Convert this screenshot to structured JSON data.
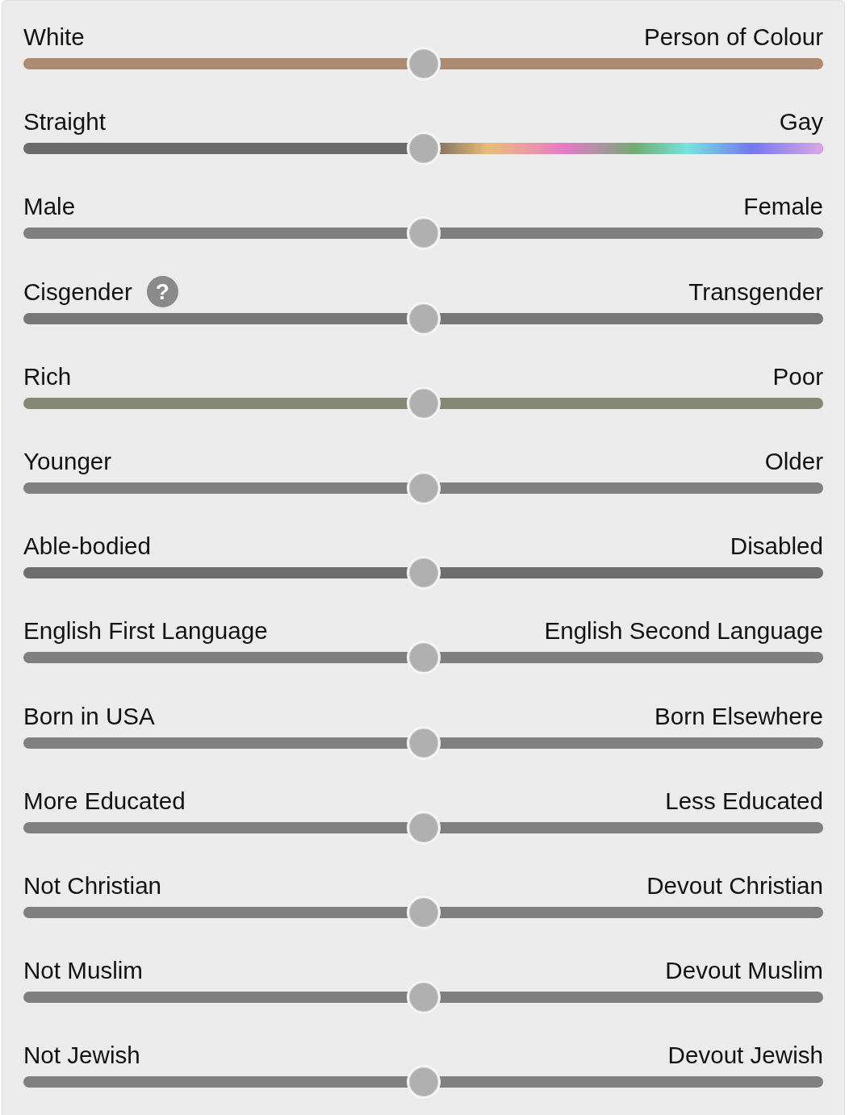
{
  "sliders": [
    {
      "left": "White",
      "right": "Person of Colour",
      "kind": "solid",
      "color": "#ad8b73",
      "level": 0.5
    },
    {
      "left": "Straight",
      "right": "Gay",
      "kind": "rainbow",
      "color": "#6b6b6b",
      "level": 0.5
    },
    {
      "left": "Male",
      "right": "Female",
      "kind": "solid",
      "color": "#7f7f7f",
      "level": 0.5
    },
    {
      "left": "Cisgender",
      "help": "?",
      "right": "Transgender",
      "kind": "solid",
      "color": "#777777",
      "level": 0.5
    },
    {
      "left": "Rich",
      "right": "Poor",
      "kind": "solid",
      "color": "#868873",
      "level": 0.5
    },
    {
      "left": "Younger",
      "right": "Older",
      "kind": "solid",
      "color": "#808080",
      "level": 0.5
    },
    {
      "left": "Able-bodied",
      "right": "Disabled",
      "kind": "solid",
      "color": "#6e6e6e",
      "level": 0.5
    },
    {
      "left": "English First Language",
      "right": "English Second Language",
      "kind": "solid",
      "color": "#7f7f7f",
      "level": 0.5
    },
    {
      "left": "Born in USA",
      "right": "Born Elsewhere",
      "kind": "solid",
      "color": "#808080",
      "level": 0.5
    },
    {
      "left": "More Educated",
      "right": "Less Educated",
      "kind": "solid",
      "color": "#808080",
      "level": 0.5
    },
    {
      "left": "Not Christian",
      "right": "Devout Christian",
      "kind": "solid",
      "color": "#7e7e7e",
      "level": 0.5
    },
    {
      "left": "Not Muslim",
      "right": "Devout Muslim",
      "kind": "solid",
      "color": "#7f7f7f",
      "level": 0.5
    },
    {
      "left": "Not Jewish",
      "right": "Devout Jewish",
      "kind": "solid",
      "color": "#808080",
      "level": 0.5
    }
  ]
}
